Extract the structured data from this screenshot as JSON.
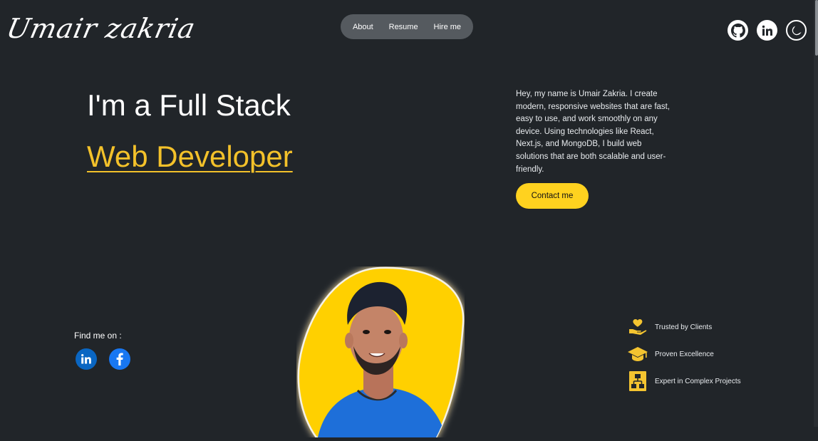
{
  "brand": {
    "logo_text": "Umair zakria"
  },
  "nav": {
    "items": [
      "About",
      "Resume",
      "Hire me"
    ]
  },
  "top_icons": [
    "github-icon",
    "linkedin-icon",
    "moon-icon"
  ],
  "hero": {
    "line1": "I'm a Full Stack",
    "line2": "Web Developer",
    "intro": "Hey, my name is Umair Zakria. I create modern, responsive websites that are fast, easy to use, and work smoothly on any device. Using technologies like React, Next.js, and MongoDB, I build web solutions that are both scalable and user-friendly.",
    "cta": "Contact me"
  },
  "find_me": {
    "label": "Find me on :",
    "icons": [
      "linkedin-icon",
      "facebook-icon"
    ]
  },
  "features": [
    {
      "icon": "heart-hand-icon",
      "label": "Trusted by Clients"
    },
    {
      "icon": "graduation-cap-icon",
      "label": "Proven Excellence"
    },
    {
      "icon": "network-icon",
      "label": "Expert in Complex Projects"
    }
  ],
  "colors": {
    "background": "#212529",
    "accent": "#ffd21f",
    "headline_accent": "#f3c12a",
    "nav_bg": "#555a5f"
  }
}
